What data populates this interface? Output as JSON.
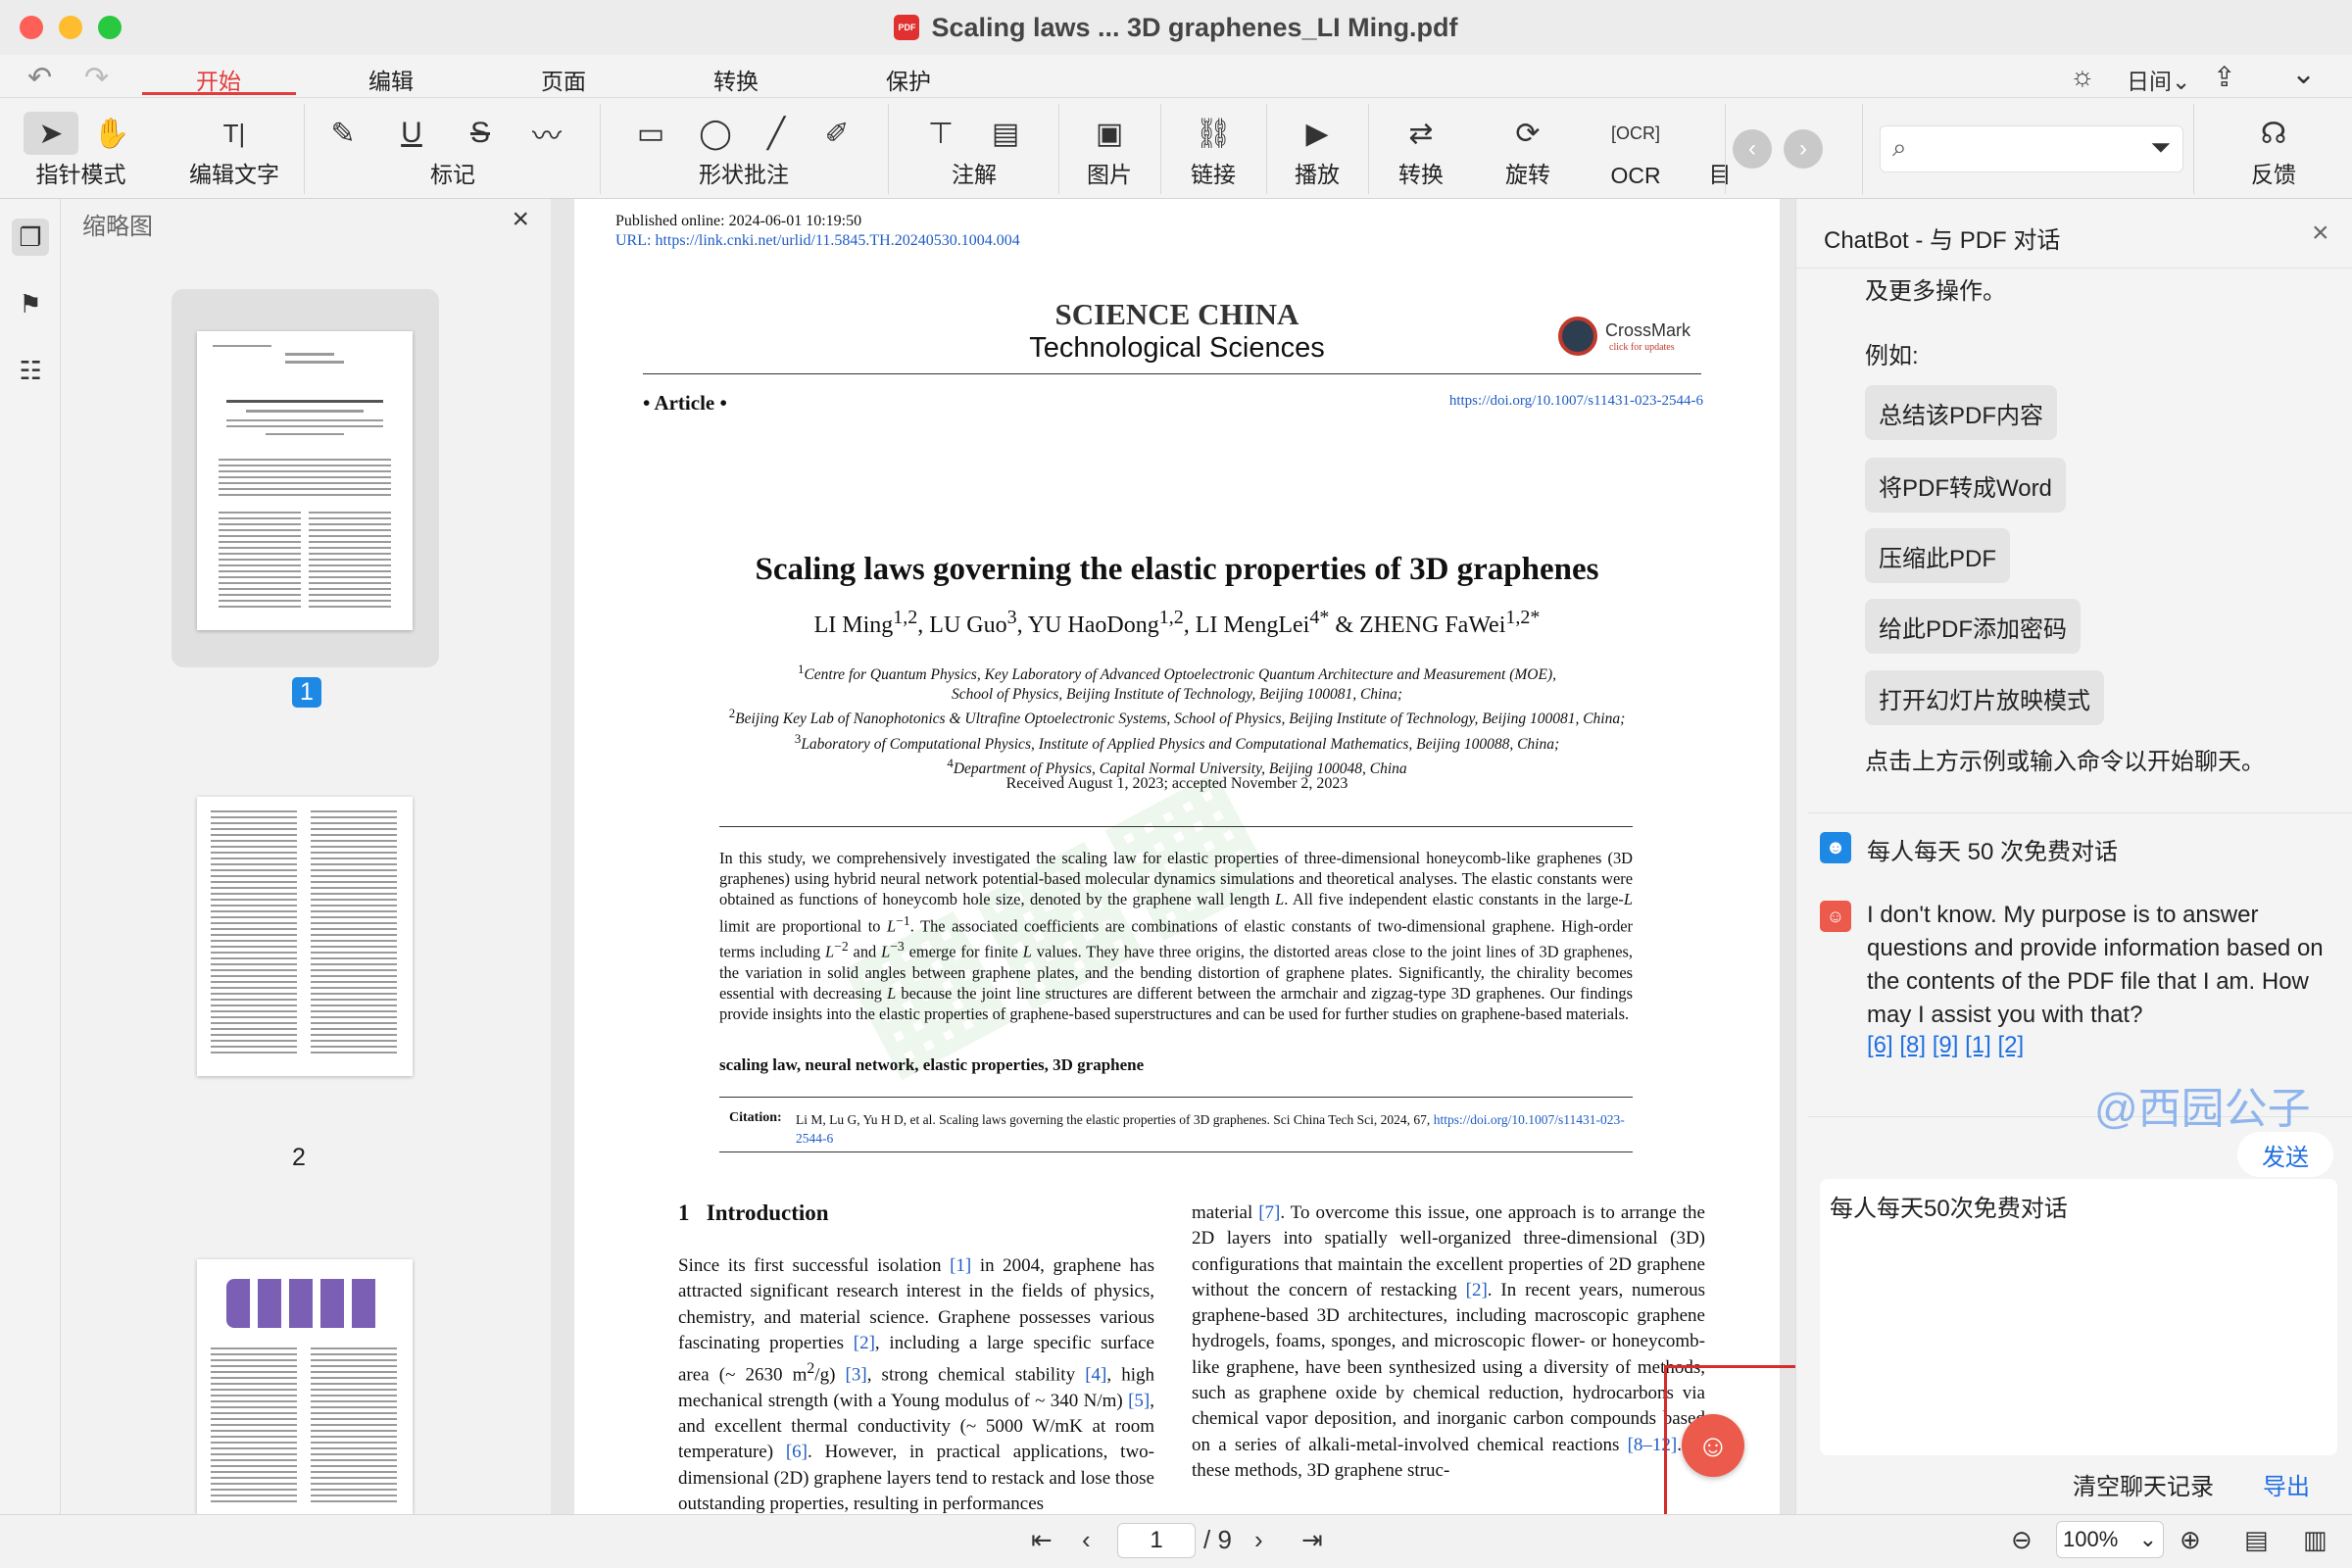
{
  "window": {
    "title": "Scaling laws ... 3D graphenes_LI Ming.pdf",
    "pdf_badge": "PDF"
  },
  "menu": {
    "undo_icon": "undo-icon",
    "redo_icon": "redo-icon",
    "tabs": [
      "开始",
      "编辑",
      "页面",
      "转换",
      "保护"
    ],
    "active_tab": "开始",
    "time_mode": "日间",
    "time_mode_chevron": "⌄"
  },
  "toolbar": {
    "pointer_mode": "指针模式",
    "edit_text": "编辑文字",
    "markup": "标记",
    "shape_annotation": "形状批注",
    "note": "注解",
    "image": "图片",
    "link": "链接",
    "play": "播放",
    "convert": "转换",
    "rotate": "旋转",
    "ocr": "OCR",
    "truncated": "目",
    "feedback": "反馈",
    "edit_text_icon": "T|"
  },
  "thumbnails": {
    "title": "缩略图",
    "pages": [
      "1",
      "2"
    ]
  },
  "document": {
    "published": "Published online:",
    "published_date": "2024-06-01 10:19:50",
    "url_label": "URL:",
    "url": "https://link.cnki.net/urlid/11.5845.TH.20240530.1004.004",
    "journal": "SCIENCE CHINA",
    "journal_sub": "Technological Sciences",
    "crossmark": "CrossMark",
    "crossmark_sub": "click for updates",
    "article": "• Article •",
    "doi": "https://doi.org/10.1007/s11431-023-2544-6",
    "title": "Scaling laws governing the elastic properties of 3D graphenes",
    "authors_html": "LI Ming<sup>1,2</sup>, LU Guo<sup>3</sup>, YU HaoDong<sup>1,2</sup>, LI MengLei<sup>4*</sup> &amp; ZHENG FaWei<sup>1,2*</sup>",
    "affil_html": "<sup>1</sup><i>Centre for Quantum Physics, Key Laboratory of Advanced Optoelectronic Quantum Architecture and Measurement (MOE),</i><br><i>School of Physics, Beijing Institute of Technology, Beijing 100081, China;</i><br><sup>2</sup><i>Beijing Key Lab of Nanophotonics &amp; Ultrafine Optoelectronic Systems, School of Physics, Beijing Institute of Technology, Beijing 100081, China;</i><br><sup>3</sup><i>Laboratory of Computational Physics, Institute of Applied Physics and Computational Mathematics, Beijing 100088, China;</i><br><sup>4</sup><i>Department of Physics, Capital Normal University, Beijing 100048, China</i>",
    "received": "Received August 1, 2023; accepted November 2, 2023",
    "abstract_html": "In this study, we comprehensively investigated the scaling law for elastic properties of three-dimensional honeycomb-like graphenes (3D graphenes) using hybrid neural network potential-based molecular dynamics simulations and theoretical analyses. The elastic constants were obtained as functions of honeycomb hole size, denoted by the graphene wall length <i>L</i>. All five independent elastic constants in the large-<i>L</i> limit are proportional to <i>L</i><sup>−1</sup>. The associated coefficients are combinations of elastic constants of two-dimensional graphene. High-order terms including <i>L</i><sup>−2</sup> and <i>L</i><sup>−3</sup> emerge for finite <i>L</i> values. They have three origins, the distorted areas close to the joint lines of 3D graphenes, the variation in solid angles between graphene plates, and the bending distortion of graphene plates. Significantly, the chirality becomes essential with decreasing <i>L</i> because the joint line structures are different between the armchair and zigzag-type 3D graphenes. Our findings provide insights into the elastic properties of graphene-based superstructures and can be used for further studies on graphene-based materials.",
    "keywords": "scaling law, neural network, elastic properties, 3D graphene",
    "citation_label": "Citation:",
    "citation_html": "Li M, Lu G, Yu H D, et al. Scaling laws governing the elastic properties of 3D graphenes. Sci China Tech Sci, 2024, 67, <span class=\"link\">https://doi.org/10.1007/s11431-023-2544-6</span>",
    "section": "1   Introduction",
    "col1_html": "Since its first successful isolation <span class=\"link\">[1]</span> in 2004, graphene has attracted significant research interest in the fields of physics, chemistry, and material science. Graphene possesses various fascinating properties <span class=\"link\">[2]</span>, including a large specific surface area (~ 2630 m<sup>2</sup>/g) <span class=\"link\">[3]</span>, strong chemical stability <span class=\"link\">[4]</span>, high mechanical strength (with a Young modulus of ~ 340 N/m) <span class=\"link\">[5]</span>, and excellent thermal conductivity (~ 5000 W/mK at room temperature) <span class=\"link\">[6]</span>. However, in practical applications, two-dimensional (2D) graphene layers tend to restack and lose those outstanding properties, resulting in performances",
    "col2_html": "material <span class=\"link\">[7]</span>. To overcome this issue, one approach is to arrange the 2D layers into spatially well-organized three-dimensional (3D) configurations that maintain the excellent properties of 2D graphene without the concern of restacking <span class=\"link\">[2]</span>. In recent years, numerous graphene-based 3D architectures, including macroscopic graphene hydrogels, foams, sponges, and microscopic flower- or honeycomb-like graphene, have been synthesized using a diversity of methods, such as graphene oxide by chemical reduction, hydrocarbons via chemical vapor deposition, and inorganic carbon compounds based on a series of alkali-metal-involved chemical reactions <span class=\"link\">[8–12]</span>. In these methods, 3D graphene struc-"
  },
  "chatbot": {
    "title": "ChatBot - 与 PDF 对话",
    "intro_tail": "及更多操作。",
    "examples_label": "例如:",
    "examples": [
      "总结该PDF内容",
      "将PDF转成Word",
      "压缩此PDF",
      "给此PDF添加密码",
      "打开幻灯片放映模式"
    ],
    "hint": "点击上方示例或输入命令以开始聊天。",
    "user_msg": "每人每天 50 次免费对话",
    "bot_reply": "I don't know. My purpose is to answer questions and provide information based on the contents of the PDF file that I am. How may I assist you with that?",
    "refs": [
      "[6]",
      "[8]",
      "[9]",
      "[1]",
      "[2]"
    ],
    "watermark": "@西园公子",
    "send": "发送",
    "input_value": "每人每天50次免费对话",
    "clear": "清空聊天记录",
    "export": "导出"
  },
  "status": {
    "page": "1",
    "total": "/ 9",
    "zoom": "100%"
  },
  "colors": {
    "accent": "#e23b3b",
    "link": "#1f5cc6",
    "badge": "#1e88e5",
    "bot": "#ec5a4b"
  }
}
